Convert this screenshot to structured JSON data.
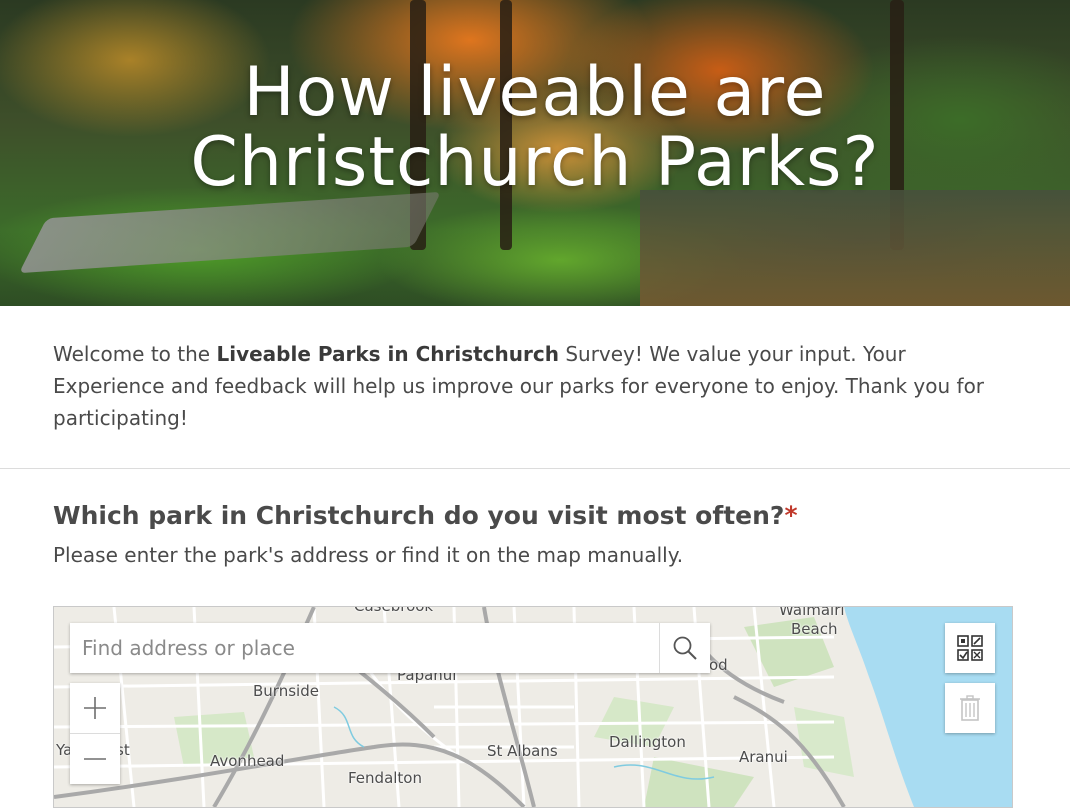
{
  "hero": {
    "title_line1": "How liveable are",
    "title_line2": "Christchurch Parks?"
  },
  "intro": {
    "text_before": "Welcome to the ",
    "bold": "Liveable Parks in Christchurch",
    "text_after": " Survey! We value your input. Your Experience and feedback will help us improve our parks for everyone to enjoy. Thank you for participating!"
  },
  "question": {
    "title": "Which park in Christchurch do you visit most often?",
    "required_mark": "*",
    "description": "Please enter the park's address or find it on the map manually."
  },
  "map": {
    "search_placeholder": "Find address or place",
    "icons": {
      "search": "search-icon",
      "zoom_in": "plus-icon",
      "zoom_out": "minus-icon",
      "qr": "qr-code-icon",
      "delete": "trash-icon"
    },
    "zoom_in_label": "+",
    "zoom_out_label": "—",
    "labels": {
      "casebrook": "Casebrook",
      "waimairi": "Waimairi",
      "beach": "Beach",
      "papanui": "Papanui",
      "wood": "od",
      "burnside": "Burnside",
      "yaldhurst_left": "Ya",
      "yaldhurst_right": "st",
      "avonhead": "Avonhead",
      "st_albans": "St Albans",
      "dallington": "Dallington",
      "aranui": "Aranui",
      "fendalton": "Fendalton"
    },
    "colors": {
      "sea": "#a8dcf2",
      "land": "#eeece6",
      "park": "#cfe3bf",
      "road": "#ffffff",
      "arterial": "#a9a9a9"
    }
  }
}
